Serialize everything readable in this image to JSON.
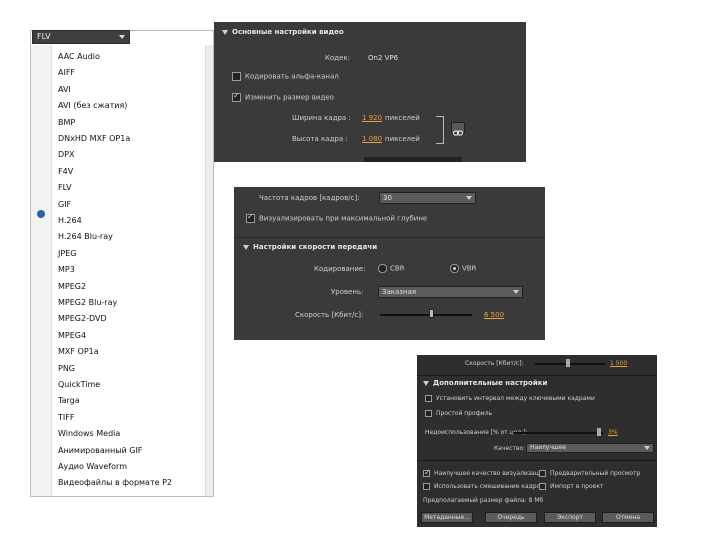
{
  "format_dropdown": {
    "value": "FLV"
  },
  "format_list": [
    "AAC Audio",
    "AIFF",
    "AVI",
    "AVI (без сжатия)",
    "BMP",
    "DNxHD MXF OP1a",
    "DPX",
    "F4V",
    "FLV",
    "GIF",
    "H.264",
    "H.264 Blu-ray",
    "JPEG",
    "MP3",
    "MPEG2",
    "MPEG2 Blu-ray",
    "MPEG2-DVD",
    "MPEG4",
    "MXF OP1a",
    "PNG",
    "QuickTime",
    "Targa",
    "TIFF",
    "Windows Media",
    "Анимированный GIF",
    "Аудио Waveform",
    "Видеофайлы в формате P2"
  ],
  "selected_format": "FLV",
  "video_basic": {
    "section_title": "Основные настройки видео",
    "codec_label": "Кодек:",
    "codec_value": "On2 VP6",
    "alpha_label": "Кодировать альфа-канал",
    "alpha_checked": false,
    "resize_label": "Изменить размер видео",
    "resize_checked": true,
    "width_label": "Ширина кадра :",
    "width_value": "1 920",
    "width_unit": "пикселей",
    "height_label": "Высота кадра :",
    "height_value": "1 080",
    "height_unit": "пикселей"
  },
  "bitrate_panel": {
    "framerate_label": "Частота кадров [кадров/с]:",
    "framerate_value": "30",
    "max_depth_label": "Визуализировать при максимальной глубине",
    "max_depth_checked": true,
    "section_title": "Настройки скорости передачи",
    "encoding_label": "Кодирование:",
    "cbr_label": "CBR",
    "vbr_label": "VBR",
    "selected_mode": "VBR",
    "level_label": "Уровень:",
    "level_value": "Заказная",
    "speed_label": "Скорость [Кбит/с]:",
    "speed_value": "6 500",
    "speed_fraction": 0.55
  },
  "advanced_panel": {
    "speed_row_label": "Скорость [Кбит/с]:",
    "speed_row_value": "1 500",
    "section_title": "Дополнительные настройки",
    "interval_label": "Установить интервал между ключевыми кадрами",
    "simple_profile_label": "Простой профиль",
    "undershoot_label": "Недоиспользование [% от цел.]:",
    "undershoot_value": "3%",
    "undershoot_fraction": 0.95,
    "quality_label": "Качество:",
    "quality_value": "Наилучшее",
    "max_quality_label": "Наилучшее качество визуализации",
    "preview_label": "Предварительный просмотр",
    "use_frame_mixing_label": "Использовать смешивание кадров",
    "import_label": "Импорт в проект",
    "file_size_label": "Предполагаемый размер файла: 8 Мб",
    "buttons": [
      "Метаданные...",
      "Очередь",
      "Экспорт",
      "Отмена"
    ]
  }
}
